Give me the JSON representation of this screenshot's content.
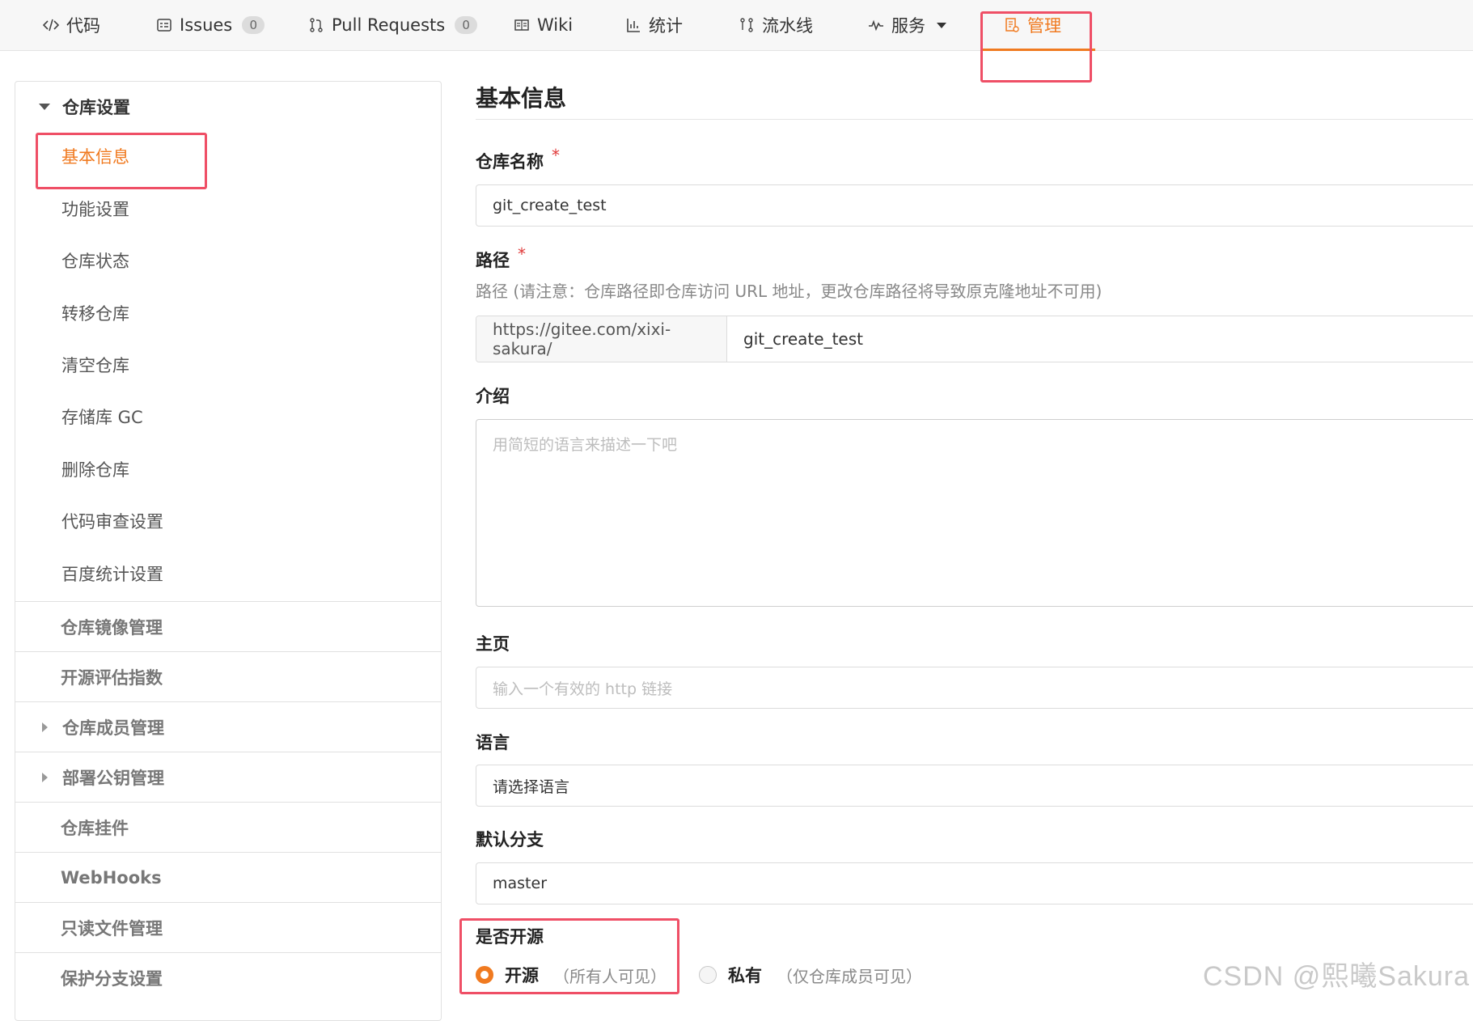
{
  "tabs": [
    {
      "label": "代码",
      "icon": "code-icon"
    },
    {
      "label": "Issues",
      "icon": "issues-icon",
      "badge": "0"
    },
    {
      "label": "Pull Requests",
      "icon": "pull-request-icon",
      "badge": "0"
    },
    {
      "label": "Wiki",
      "icon": "wiki-icon"
    },
    {
      "label": "统计",
      "icon": "stats-icon"
    },
    {
      "label": "流水线",
      "icon": "pipeline-icon"
    },
    {
      "label": "服务",
      "icon": "service-icon"
    },
    {
      "label": "管理",
      "icon": "manage-icon",
      "active": true
    }
  ],
  "sidebar": {
    "group_title": "仓库设置",
    "items": [
      "基本信息",
      "功能设置",
      "仓库状态",
      "转移仓库",
      "清空仓库",
      "存储库 GC",
      "删除仓库",
      "代码审查设置",
      "百度统计设置"
    ],
    "active_item": "基本信息",
    "sections": [
      "仓库镜像管理",
      "开源评估指数",
      "仓库成员管理",
      "部署公钥管理",
      "仓库挂件",
      "WebHooks",
      "只读文件管理",
      "保护分支设置"
    ]
  },
  "form": {
    "title": "基本信息",
    "repo_name_label": "仓库名称",
    "required_mark": "*",
    "repo_name_value": "git_create_test",
    "path_label": "路径",
    "path_hint": "路径 (请注意：仓库路径即仓库访问 URL 地址，更改仓库路径将导致原克隆地址不可用)",
    "path_prefix": "https://gitee.com/xixi-sakura/",
    "path_value": "git_create_test",
    "intro_label": "介绍",
    "intro_placeholder": "用简短的语言来描述一下吧",
    "homepage_label": "主页",
    "homepage_placeholder": "输入一个有效的 http 链接",
    "language_label": "语言",
    "language_value": "请选择语言",
    "branch_label": "默认分支",
    "branch_value": "master",
    "visibility_label": "是否开源",
    "option_public": "开源",
    "option_public_note": "（所有人可见）",
    "option_private": "私有",
    "option_private_note": "（仅仓库成员可见）",
    "selected_option": "开源"
  },
  "watermark": "CSDN @熙曦Sakura",
  "colors": {
    "accent": "#f07a20",
    "highlight": "#ef4f66",
    "required": "#e03a3a"
  }
}
